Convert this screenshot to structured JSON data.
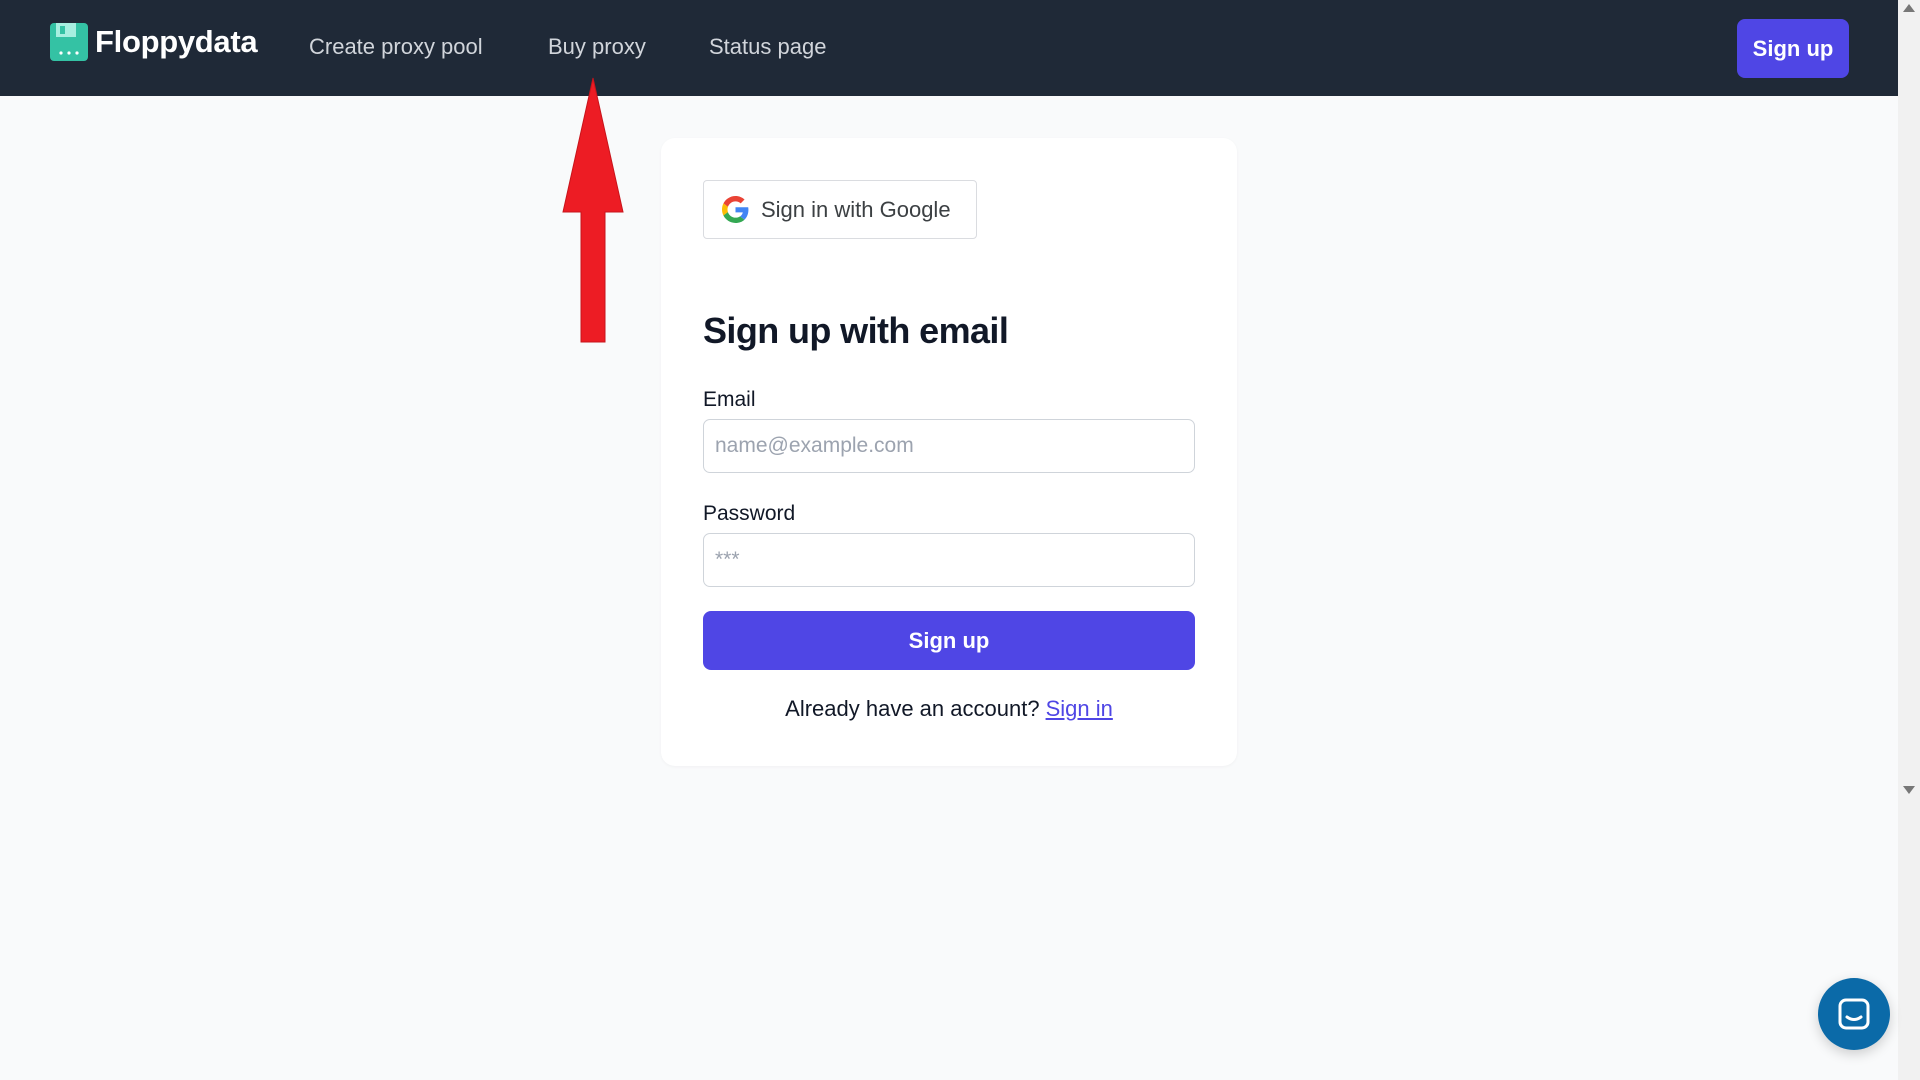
{
  "nav": {
    "brand": "Floppydata",
    "links": [
      "Create proxy pool",
      "Buy proxy",
      "Status page"
    ],
    "signup_label": "Sign up"
  },
  "google_button": {
    "label": "Sign in with Google"
  },
  "form": {
    "heading": "Sign up with email",
    "email_label": "Email",
    "email_placeholder": "name@example.com",
    "password_label": "Password",
    "password_placeholder": "***",
    "submit_label": "Sign up",
    "signin_prompt": "Already have an account?",
    "signin_link": "Sign in"
  },
  "colors": {
    "navbar": "#1f2937",
    "accent": "#4f46e5",
    "page_background": "#f9fafb",
    "brand_icon": "#34c2a4",
    "annotation_arrow": "#ed1c24",
    "chat_launcher": "#0b6aa8"
  },
  "icons": {
    "brand": "floppy-disk-icon",
    "google": "google-g-icon",
    "chat": "chat-bubble-icon",
    "annotation": "red-arrow-up"
  }
}
